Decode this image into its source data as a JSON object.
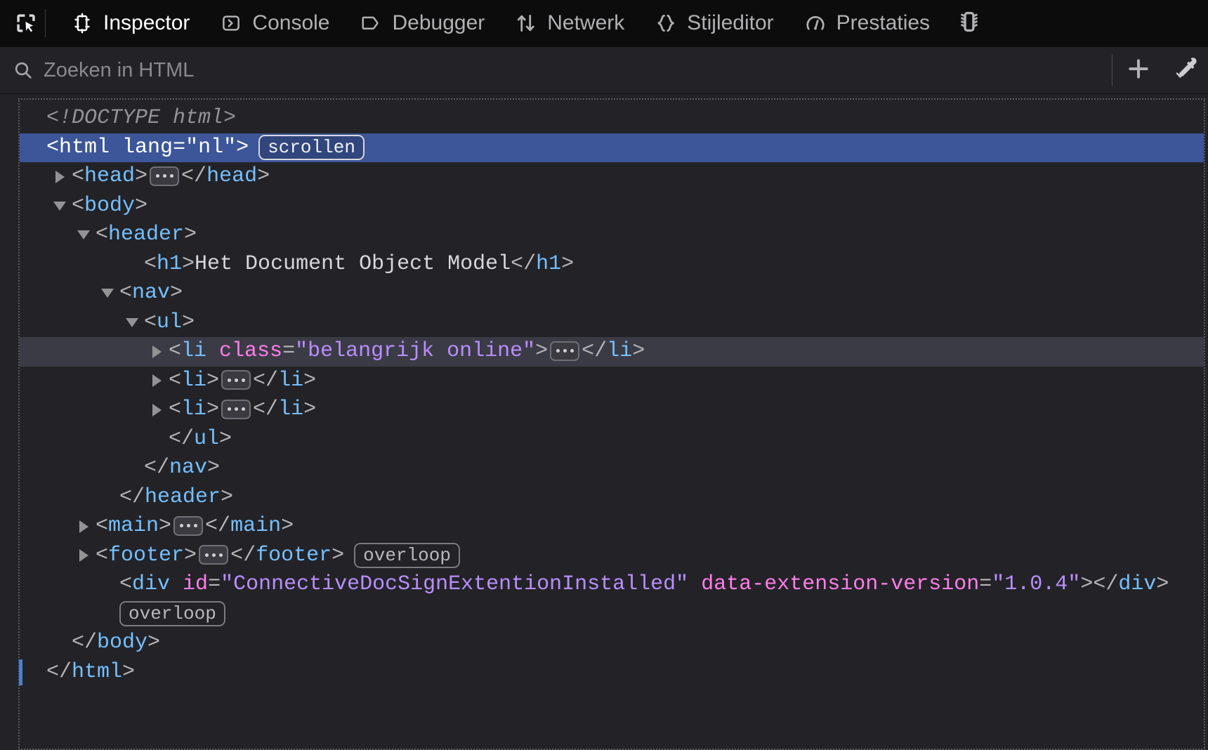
{
  "toolbar": {
    "picker_tooltip": "Element kiezen",
    "tabs": [
      {
        "id": "inspector",
        "label": "Inspector",
        "icon": "inspector-icon",
        "selected": true
      },
      {
        "id": "console",
        "label": "Console",
        "icon": "console-icon",
        "selected": false
      },
      {
        "id": "debugger",
        "label": "Debugger",
        "icon": "debugger-icon",
        "selected": false
      },
      {
        "id": "netwerk",
        "label": "Netwerk",
        "icon": "network-icon",
        "selected": false
      },
      {
        "id": "stijleditor",
        "label": "Stijleditor",
        "icon": "style-editor-icon",
        "selected": false
      },
      {
        "id": "prestaties",
        "label": "Prestaties",
        "icon": "performance-icon",
        "selected": false
      }
    ],
    "overflow_tab_icon": "memory-chip-icon"
  },
  "search": {
    "placeholder": "Zoeken in HTML",
    "value": "",
    "icon": "search-icon",
    "add_node_icon": "plus-icon",
    "eyedropper_icon": "eyedropper-icon"
  },
  "badges": {
    "scroll": "scrollen",
    "overflow": "overloop"
  },
  "markup": {
    "nodes": [
      {
        "id": "doctype",
        "indent": 0,
        "twisty": "none",
        "state": "normal",
        "parts": [
          {
            "type": "doctype",
            "text": "<!DOCTYPE html>"
          }
        ]
      },
      {
        "id": "html-open",
        "indent": 0,
        "twisty": "none",
        "state": "selected",
        "parts": [
          {
            "type": "punct",
            "text": "<"
          },
          {
            "type": "tag",
            "text": "html"
          },
          {
            "type": "punct",
            "text": " "
          },
          {
            "type": "attr-name",
            "text": "lang"
          },
          {
            "type": "punct",
            "text": "="
          },
          {
            "type": "attr-value",
            "text": "\"nl\""
          },
          {
            "type": "punct",
            "text": ">"
          },
          {
            "type": "badge",
            "text": "scrollen"
          }
        ]
      },
      {
        "id": "head",
        "indent": 1,
        "twisty": "closed",
        "state": "normal",
        "parts": [
          {
            "type": "punct",
            "text": "<"
          },
          {
            "type": "tag",
            "text": "head"
          },
          {
            "type": "punct",
            "text": ">"
          },
          {
            "type": "ellipsis",
            "text": "..."
          },
          {
            "type": "punct",
            "text": "</"
          },
          {
            "type": "tag",
            "text": "head"
          },
          {
            "type": "punct",
            "text": ">"
          }
        ]
      },
      {
        "id": "body-open",
        "indent": 1,
        "twisty": "open",
        "state": "normal",
        "parts": [
          {
            "type": "punct",
            "text": "<"
          },
          {
            "type": "tag",
            "text": "body"
          },
          {
            "type": "punct",
            "text": ">"
          }
        ]
      },
      {
        "id": "header-open",
        "indent": 2,
        "twisty": "open",
        "state": "normal",
        "parts": [
          {
            "type": "punct",
            "text": "<"
          },
          {
            "type": "tag",
            "text": "header"
          },
          {
            "type": "punct",
            "text": ">"
          }
        ]
      },
      {
        "id": "h1",
        "indent": 4,
        "twisty": "none",
        "state": "normal",
        "parts": [
          {
            "type": "punct",
            "text": "<"
          },
          {
            "type": "tag",
            "text": "h1"
          },
          {
            "type": "punct",
            "text": ">"
          },
          {
            "type": "text",
            "text": "Het Document Object Model"
          },
          {
            "type": "punct",
            "text": "</"
          },
          {
            "type": "tag",
            "text": "h1"
          },
          {
            "type": "punct",
            "text": ">"
          }
        ]
      },
      {
        "id": "nav-open",
        "indent": 3,
        "twisty": "open",
        "state": "normal",
        "parts": [
          {
            "type": "punct",
            "text": "<"
          },
          {
            "type": "tag",
            "text": "nav"
          },
          {
            "type": "punct",
            "text": ">"
          }
        ]
      },
      {
        "id": "ul-open",
        "indent": 4,
        "twisty": "open",
        "state": "normal",
        "parts": [
          {
            "type": "punct",
            "text": "<"
          },
          {
            "type": "tag",
            "text": "ul"
          },
          {
            "type": "punct",
            "text": ">"
          }
        ]
      },
      {
        "id": "li-1",
        "indent": 5,
        "twisty": "closed",
        "state": "hovered",
        "parts": [
          {
            "type": "punct",
            "text": "<"
          },
          {
            "type": "tag",
            "text": "li"
          },
          {
            "type": "punct",
            "text": " "
          },
          {
            "type": "attr-name",
            "text": "class"
          },
          {
            "type": "punct",
            "text": "="
          },
          {
            "type": "attr-value",
            "text": "\"belangrijk online\""
          },
          {
            "type": "punct",
            "text": ">"
          },
          {
            "type": "ellipsis",
            "text": "..."
          },
          {
            "type": "punct",
            "text": "</"
          },
          {
            "type": "tag",
            "text": "li"
          },
          {
            "type": "punct",
            "text": ">"
          }
        ]
      },
      {
        "id": "li-2",
        "indent": 5,
        "twisty": "closed",
        "state": "normal",
        "parts": [
          {
            "type": "punct",
            "text": "<"
          },
          {
            "type": "tag",
            "text": "li"
          },
          {
            "type": "punct",
            "text": ">"
          },
          {
            "type": "ellipsis",
            "text": "..."
          },
          {
            "type": "punct",
            "text": "</"
          },
          {
            "type": "tag",
            "text": "li"
          },
          {
            "type": "punct",
            "text": ">"
          }
        ]
      },
      {
        "id": "li-3",
        "indent": 5,
        "twisty": "closed",
        "state": "normal",
        "parts": [
          {
            "type": "punct",
            "text": "<"
          },
          {
            "type": "tag",
            "text": "li"
          },
          {
            "type": "punct",
            "text": ">"
          },
          {
            "type": "ellipsis",
            "text": "..."
          },
          {
            "type": "punct",
            "text": "</"
          },
          {
            "type": "tag",
            "text": "li"
          },
          {
            "type": "punct",
            "text": ">"
          }
        ]
      },
      {
        "id": "ul-close",
        "indent": 5,
        "twisty": "none",
        "state": "normal",
        "parts": [
          {
            "type": "punct",
            "text": "</"
          },
          {
            "type": "tag",
            "text": "ul"
          },
          {
            "type": "punct",
            "text": ">"
          }
        ]
      },
      {
        "id": "nav-close",
        "indent": 4,
        "twisty": "none",
        "state": "normal",
        "parts": [
          {
            "type": "punct",
            "text": "</"
          },
          {
            "type": "tag",
            "text": "nav"
          },
          {
            "type": "punct",
            "text": ">"
          }
        ]
      },
      {
        "id": "header-close",
        "indent": 3,
        "twisty": "none",
        "state": "normal",
        "parts": [
          {
            "type": "punct",
            "text": "</"
          },
          {
            "type": "tag",
            "text": "header"
          },
          {
            "type": "punct",
            "text": ">"
          }
        ]
      },
      {
        "id": "main",
        "indent": 2,
        "twisty": "closed",
        "state": "normal",
        "parts": [
          {
            "type": "punct",
            "text": "<"
          },
          {
            "type": "tag",
            "text": "main"
          },
          {
            "type": "punct",
            "text": ">"
          },
          {
            "type": "ellipsis",
            "text": "..."
          },
          {
            "type": "punct",
            "text": "</"
          },
          {
            "type": "tag",
            "text": "main"
          },
          {
            "type": "punct",
            "text": ">"
          }
        ]
      },
      {
        "id": "footer",
        "indent": 2,
        "twisty": "closed",
        "state": "normal",
        "parts": [
          {
            "type": "punct",
            "text": "<"
          },
          {
            "type": "tag",
            "text": "footer"
          },
          {
            "type": "punct",
            "text": ">"
          },
          {
            "type": "ellipsis",
            "text": "..."
          },
          {
            "type": "punct",
            "text": "</"
          },
          {
            "type": "tag",
            "text": "footer"
          },
          {
            "type": "punct",
            "text": ">"
          },
          {
            "type": "badge",
            "text": "overloop"
          }
        ]
      },
      {
        "id": "div-connective",
        "indent": 3,
        "twisty": "none",
        "state": "normal",
        "parts": [
          {
            "type": "punct",
            "text": "<"
          },
          {
            "type": "tag",
            "text": "div"
          },
          {
            "type": "punct",
            "text": " "
          },
          {
            "type": "attr-name",
            "text": "id"
          },
          {
            "type": "punct",
            "text": "="
          },
          {
            "type": "attr-value",
            "text": "\"ConnectiveDocSignExtentionInstalled\""
          },
          {
            "type": "punct",
            "text": " "
          },
          {
            "type": "attr-name",
            "text": "data-extension-version"
          },
          {
            "type": "punct",
            "text": "="
          },
          {
            "type": "attr-value",
            "text": "\"1.0.4\""
          },
          {
            "type": "punct",
            "text": ">"
          },
          {
            "type": "punct",
            "text": "</"
          },
          {
            "type": "tag",
            "text": "div"
          },
          {
            "type": "punct",
            "text": ">"
          }
        ]
      },
      {
        "id": "div-connective-badge-line",
        "indent": 3,
        "twisty": "none",
        "state": "normal",
        "badge_only": true,
        "parts": [
          {
            "type": "badge",
            "text": "overloop"
          }
        ]
      },
      {
        "id": "body-close",
        "indent": 1,
        "twisty": "none",
        "state": "normal",
        "parts": [
          {
            "type": "punct",
            "text": "</"
          },
          {
            "type": "tag",
            "text": "body"
          },
          {
            "type": "punct",
            "text": ">"
          }
        ]
      },
      {
        "id": "html-close",
        "indent": 0,
        "twisty": "none",
        "state": "sel-bar",
        "parts": [
          {
            "type": "punct",
            "text": "</"
          },
          {
            "type": "tag",
            "text": "html"
          },
          {
            "type": "punct",
            "text": ">"
          }
        ]
      }
    ]
  },
  "colors": {
    "background": "#232327",
    "toolbar_background": "#0c0c0d",
    "selection": "#3c5699",
    "hover": "#3b3b46",
    "tag": "#75bfff",
    "attr_name": "#ff7de9",
    "attr_value": "#b98eff",
    "punctuation": "#b6b6b8",
    "text": "#d7d7db",
    "doctype": "#939395"
  }
}
